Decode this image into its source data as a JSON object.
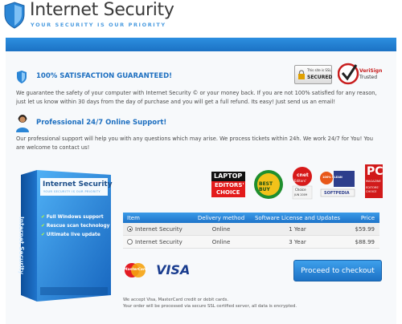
{
  "header": {
    "title": "Internet Security",
    "tagline": "YOUR SECURITY IS OUR PRIORITY"
  },
  "colors": {
    "brand_blue": "#1d6fc0",
    "bar_blue": "#2d8fe0",
    "panel_bg": "#f7f9fb"
  },
  "guarantee": {
    "icon": "shield-icon",
    "title": "100% SATISFACTION GUARANTEED!",
    "text": "We guarantee the safety of your computer with Internet Security © or your money back. If you are not 100% satisfied for any reason, just let us know within 30 days from the day of purchase and you will get a full refund. Its easy! Just send us an email!"
  },
  "support": {
    "icon": "support-agent-icon",
    "title": "Professional 24/7 Online Support!",
    "text": "Our professional support will help you with any questions which may arise. We process tickets within 24h. We work 24/7 for You! You are welcome to contact us!"
  },
  "trust_badges": {
    "ssl": {
      "line1": "This site is SSL",
      "line2": "SECURED"
    },
    "verisign": {
      "line1": "VeriSign",
      "line2": "Trusted"
    }
  },
  "product_box": {
    "title": "Internet Security",
    "subtitle": "YOUR SECURITY IS OUR PRIORITY",
    "features": [
      "Full Windows support",
      "Rescue scan technology",
      "Ultimate live update"
    ]
  },
  "awards": {
    "laptop": {
      "line1": "LAPTOP",
      "line2": "EDITORS'",
      "line3": "CHOICE"
    },
    "bestbuy": {
      "text": "BEST BUY"
    },
    "cnet": {
      "line1": "cnet",
      "line2": "Editors'",
      "line3": "Choice",
      "date": "JUN 2009"
    },
    "softpedia": {
      "text": "SOFTPEDIA",
      "rating": "100% CLEAN"
    },
    "pcmag": {
      "line1": "PC",
      "line2": "MAGAZINE",
      "line3": "EDITORS' CHOICE"
    }
  },
  "pricing_table": {
    "headers": [
      "Item",
      "Delivery method",
      "Software License and Updates",
      "Price"
    ],
    "rows": [
      {
        "item": "Internet Security",
        "delivery": "Online",
        "license": "1 Year",
        "price": "$59.99",
        "selected": true
      },
      {
        "item": "Internet Security",
        "delivery": "Online",
        "license": "3 Year",
        "price": "$88.99",
        "selected": false
      }
    ]
  },
  "payment": {
    "mastercard": "MasterCard",
    "visa": "VISA"
  },
  "checkout_button": "Proceed to checkout",
  "footnote": {
    "line1": "We accept Visa, MasterCard credit or debit cards.",
    "line2": "Your order will be processed via secure SSL certified server, all data is encrypted."
  }
}
